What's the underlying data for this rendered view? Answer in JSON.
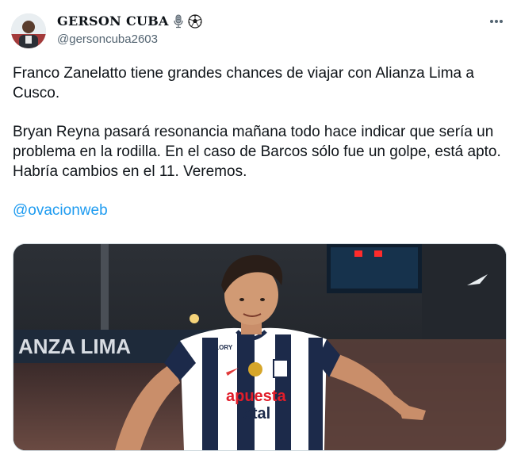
{
  "author": {
    "display_name": "GERSON CUBA",
    "handle": "@gersoncuba2603",
    "badges": [
      "microphone-icon",
      "soccer-ball-icon"
    ],
    "more_icon": "more-horizontal-icon"
  },
  "tweet": {
    "paragraph_1": "Franco Zanelatto tiene grandes chances de viajar con Alianza Lima a Cusco.",
    "paragraph_2": "Bryan Reyna pasará resonancia mañana todo hace indicar que sería un problema en la rodilla. En el caso de Barcos sólo fue un golpe, está apto. Habría cambios en el 11. Veremos.",
    "mention": "@ovacionweb"
  },
  "media": {
    "stadium_sign": "ANZA LIMA",
    "jersey_sponsor_line1": "apuesta",
    "jersey_sponsor_line2": "total",
    "jersey_brand": "GLORY"
  },
  "colors": {
    "accent": "#1d9bf0",
    "text": "#0f1419",
    "secondary": "#536471",
    "border": "#cfd9de"
  }
}
